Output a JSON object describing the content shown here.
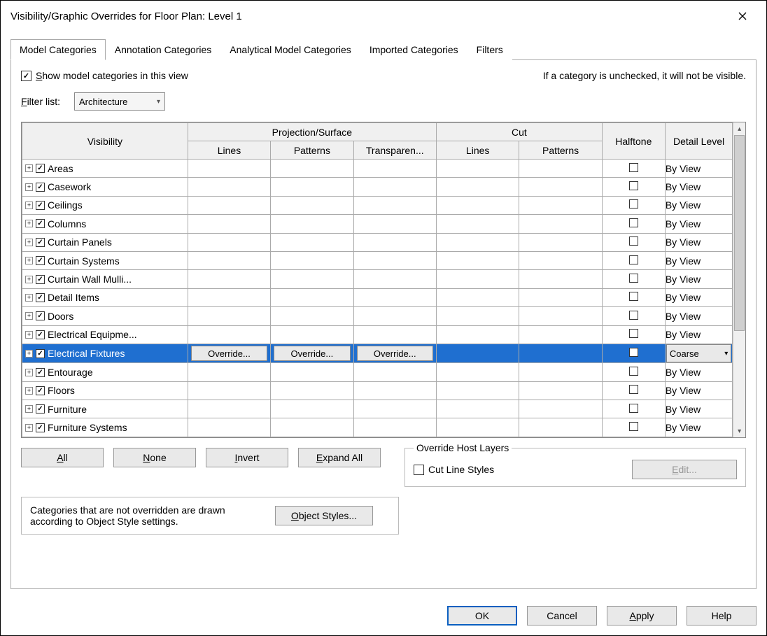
{
  "dialog": {
    "title": "Visibility/Graphic Overrides for Floor Plan: Level 1"
  },
  "tabs": [
    {
      "label": "Model Categories",
      "active": true
    },
    {
      "label": "Annotation Categories",
      "active": false
    },
    {
      "label": "Analytical Model Categories",
      "active": false
    },
    {
      "label": "Imported Categories",
      "active": false
    },
    {
      "label": "Filters",
      "active": false
    }
  ],
  "show_checkbox": {
    "pre": "S",
    "post": "how model categories in this view",
    "checked": true
  },
  "hint": "If a category is unchecked, it will not be visible.",
  "filter": {
    "pre": "F",
    "post": "ilter list:",
    "value": "Architecture"
  },
  "headers": {
    "visibility": "Visibility",
    "proj": "Projection/Surface",
    "cut": "Cut",
    "halftone": "Halftone",
    "detail": "Detail Level",
    "lines": "Lines",
    "patterns": "Patterns",
    "transp": "Transparen..."
  },
  "rows": [
    {
      "name": "Areas",
      "proj_hatch": true,
      "cut_hatch": true,
      "detail": "By View"
    },
    {
      "name": "Casework",
      "detail": "By View"
    },
    {
      "name": "Ceilings",
      "detail": "By View"
    },
    {
      "name": "Columns",
      "detail": "By View"
    },
    {
      "name": "Curtain Panels",
      "detail": "By View"
    },
    {
      "name": "Curtain Systems",
      "detail": "By View"
    },
    {
      "name": "Curtain Wall Mulli...",
      "detail": "By View"
    },
    {
      "name": "Detail Items",
      "cut_hatch": true,
      "detail": "By View"
    },
    {
      "name": "Doors",
      "detail": "By View"
    },
    {
      "name": "Electrical Equipme...",
      "cut_hatch": true,
      "detail": "By View"
    },
    {
      "name": "Electrical Fixtures",
      "selected": true,
      "override": "Override...",
      "cut_hatch": true,
      "detail": "Coarse",
      "detail_combo": true
    },
    {
      "name": "Entourage",
      "cut_hatch": true,
      "detail": "By View"
    },
    {
      "name": "Floors",
      "detail": "By View"
    },
    {
      "name": "Furniture",
      "cut_hatch": true,
      "detail": "By View"
    },
    {
      "name": "Furniture Systems",
      "cut_hatch": true,
      "detail": "By View"
    }
  ],
  "btns": {
    "all": {
      "pre": "A",
      "post": "ll"
    },
    "none": {
      "pre": "N",
      "post": "one"
    },
    "invert": {
      "pre": "I",
      "post": "nvert"
    },
    "expand": {
      "pre": "E",
      "post": "xpand All"
    },
    "objstyles": {
      "pre": "O",
      "post": "bject Styles..."
    },
    "edit": {
      "pre": "E",
      "post": "dit..."
    }
  },
  "note": "Categories that are not overridden are drawn according to Object Style settings.",
  "host": {
    "legend": "Override Host Layers",
    "chk": "Cut Line Styles"
  },
  "bottom": {
    "ok": "OK",
    "cancel": "Cancel",
    "apply": {
      "pre": "A",
      "post": "pply"
    },
    "help": "Help"
  }
}
